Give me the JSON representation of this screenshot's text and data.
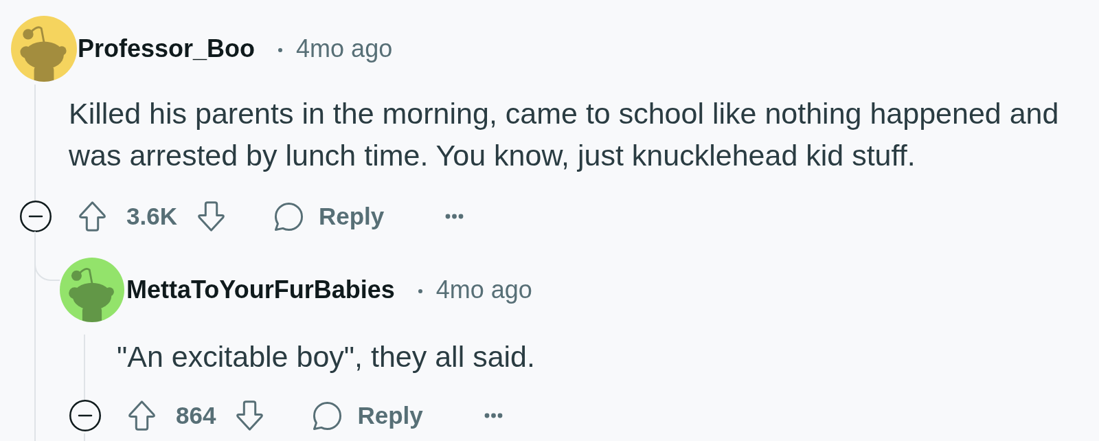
{
  "comments": [
    {
      "author": "Professor_Boo",
      "time": "4mo ago",
      "color": "#f5d45e",
      "body": "Killed his parents in the morning, came to school like nothing happened and was arrested by lunch time. You know, just knucklehead kid stuff.",
      "expanded": true,
      "score": "3.6K",
      "reply_label": "Reply",
      "children": [
        {
          "author": "MettaToYourFurBabies",
          "time": "4mo ago",
          "color": "#93e36b",
          "body": "\"An excitable boy\", they all said.",
          "expanded": true,
          "score": "864",
          "reply_label": "Reply"
        }
      ]
    }
  ]
}
